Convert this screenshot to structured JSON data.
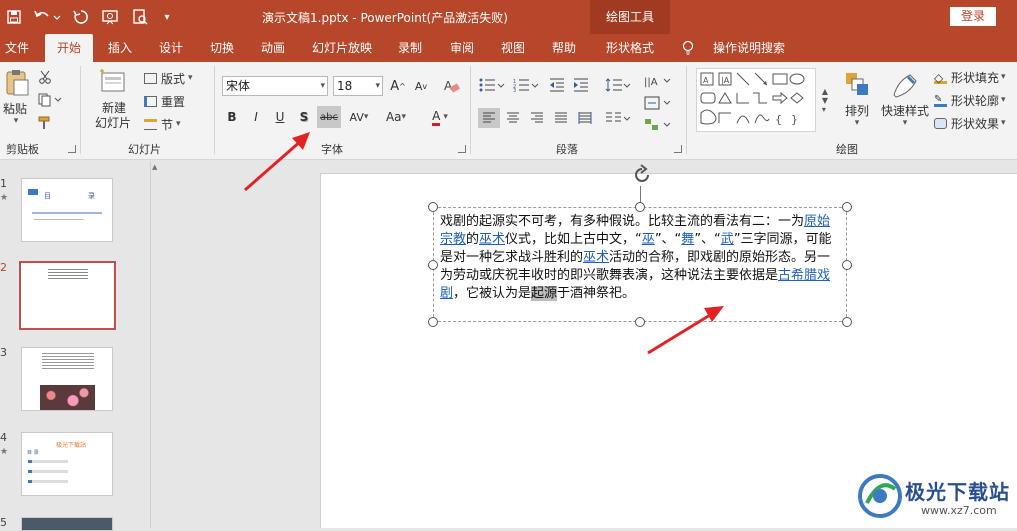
{
  "titlebar": {
    "doc_title": "演示文稿1.pptx  -  PowerPoint(产品激活失败)",
    "context_tab": "绘图工具",
    "login": "登录",
    "bg_color": "#b7472a"
  },
  "tabs": [
    "文件",
    "开始",
    "插入",
    "设计",
    "切换",
    "动画",
    "幻灯片放映",
    "录制",
    "审阅",
    "视图",
    "帮助",
    "形状格式",
    "操作说明搜索"
  ],
  "active_tab": "开始",
  "ribbon": {
    "clipboard": {
      "paste": "粘贴",
      "label": "剪贴板"
    },
    "slides": {
      "new_slide_line1": "新建",
      "new_slide_line2": "幻灯片",
      "layout": "版式",
      "reset": "重置",
      "section": "节",
      "label": "幻灯片"
    },
    "font": {
      "font_name": "宋体",
      "font_size": "18",
      "label": "字体",
      "bold": "B",
      "italic": "I",
      "underline": "U",
      "shadow": "S",
      "strike": "abc",
      "spacing": "AV",
      "case": "Aa",
      "color": "A",
      "grow": "A",
      "shrink": "A"
    },
    "paragraph": {
      "label": "段落"
    },
    "drawing": {
      "arrange": "排列",
      "quick_styles": "快速样式",
      "fill": "形状填充",
      "outline": "形状轮廓",
      "effects": "形状效果",
      "label": "绘图"
    }
  },
  "slides_pane": {
    "numbers": [
      "1",
      "2",
      "3",
      "4",
      "5"
    ],
    "selected": "2",
    "thumb1": {
      "title_left": "目",
      "title_right": "录"
    },
    "thumb4": {
      "title": "极光下载站",
      "sub": "目 录"
    }
  },
  "textbox": {
    "segments": [
      {
        "t": "戏剧的起源实不可考，有多种假说。比较主流的看法有二：一为",
        "k": "n"
      },
      {
        "t": "原始宗教",
        "k": "link"
      },
      {
        "t": "的",
        "k": "n"
      },
      {
        "t": "巫术",
        "k": "link"
      },
      {
        "t": "仪式，比如上古中文，“",
        "k": "n"
      },
      {
        "t": "巫",
        "k": "link"
      },
      {
        "t": "”、“",
        "k": "n"
      },
      {
        "t": "舞",
        "k": "link"
      },
      {
        "t": "”、“",
        "k": "n"
      },
      {
        "t": "武",
        "k": "link"
      },
      {
        "t": "”三字同源，可能是对一种乞求战斗胜利的",
        "k": "n"
      },
      {
        "t": "巫术",
        "k": "link"
      },
      {
        "t": "活动的合称，即戏剧的原始形态。另一为劳动或庆祝丰收时的即兴歌舞表演，这种说法主要依据是",
        "k": "n"
      },
      {
        "t": "古希腊戏剧",
        "k": "link"
      },
      {
        "t": "，它被认为是",
        "k": "n"
      },
      {
        "t": "起源",
        "k": "hl"
      },
      {
        "t": "于酒神祭祀。",
        "k": "n"
      }
    ]
  },
  "watermark": {
    "brand": "极光下载站",
    "url": "www.xz7.com"
  },
  "colors": {
    "accent": "#b7472a",
    "arrow": "#e02424",
    "link": "#1f5fbf"
  }
}
